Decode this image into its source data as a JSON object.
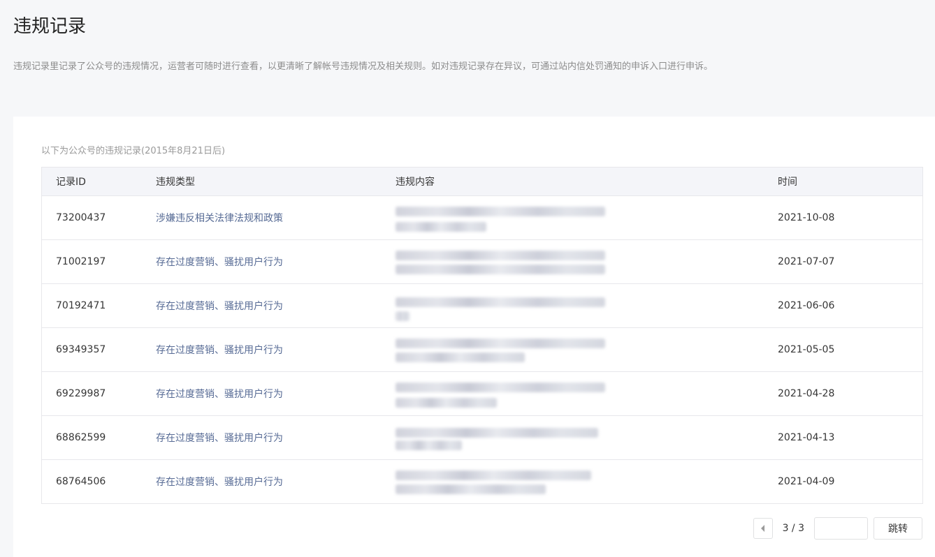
{
  "header": {
    "title": "违规记录",
    "description": "违规记录里记录了公众号的违规情况，运营者可随时进行查看，以更清晰了解帐号违规情况及相关规则。如对违规记录存在异议，可通过站内信处罚通知的申诉入口进行申诉。"
  },
  "card": {
    "intro": "以下为公众号的违规记录(2015年8月21日后)"
  },
  "table": {
    "columns": [
      "记录ID",
      "违规类型",
      "违规内容",
      "时间"
    ],
    "rows": [
      {
        "id": "73200437",
        "type": "涉嫌违反相关法律法规和政策",
        "date": "2021-10-08"
      },
      {
        "id": "71002197",
        "type": "存在过度营销、骚扰用户行为",
        "date": "2021-07-07"
      },
      {
        "id": "70192471",
        "type": "存在过度营销、骚扰用户行为",
        "date": "2021-06-06"
      },
      {
        "id": "69349357",
        "type": "存在过度营销、骚扰用户行为",
        "date": "2021-05-05"
      },
      {
        "id": "69229987",
        "type": "存在过度营销、骚扰用户行为",
        "date": "2021-04-28"
      },
      {
        "id": "68862599",
        "type": "存在过度营销、骚扰用户行为",
        "date": "2021-04-13"
      },
      {
        "id": "68764506",
        "type": "存在过度营销、骚扰用户行为",
        "date": "2021-04-09"
      }
    ]
  },
  "pagination": {
    "page_indicator": "3 / 3",
    "jump_input_value": "",
    "jump_label": "跳转",
    "prev_icon": "chevron-left-icon"
  }
}
